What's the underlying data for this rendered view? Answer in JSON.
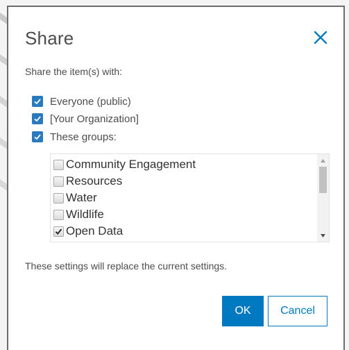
{
  "dialog": {
    "title": "Share",
    "close_icon": "close-icon",
    "subtitle": "Share the item(s) with:",
    "options": [
      {
        "label": "Everyone (public)",
        "checked": true
      },
      {
        "label": "[Your Organization]",
        "checked": true
      },
      {
        "label": "These groups:",
        "checked": true
      }
    ],
    "groups": [
      {
        "label": "Community Engagement",
        "checked": false
      },
      {
        "label": "Resources",
        "checked": false
      },
      {
        "label": "Water",
        "checked": false
      },
      {
        "label": "Wildlife",
        "checked": false
      },
      {
        "label": "Open Data",
        "checked": true
      }
    ],
    "note": "These settings will replace the current settings.",
    "ok_label": "OK",
    "cancel_label": "Cancel"
  },
  "colors": {
    "accent": "#0079c1",
    "checkbox": "#2a7ac0",
    "text": "#4c4c4c"
  }
}
